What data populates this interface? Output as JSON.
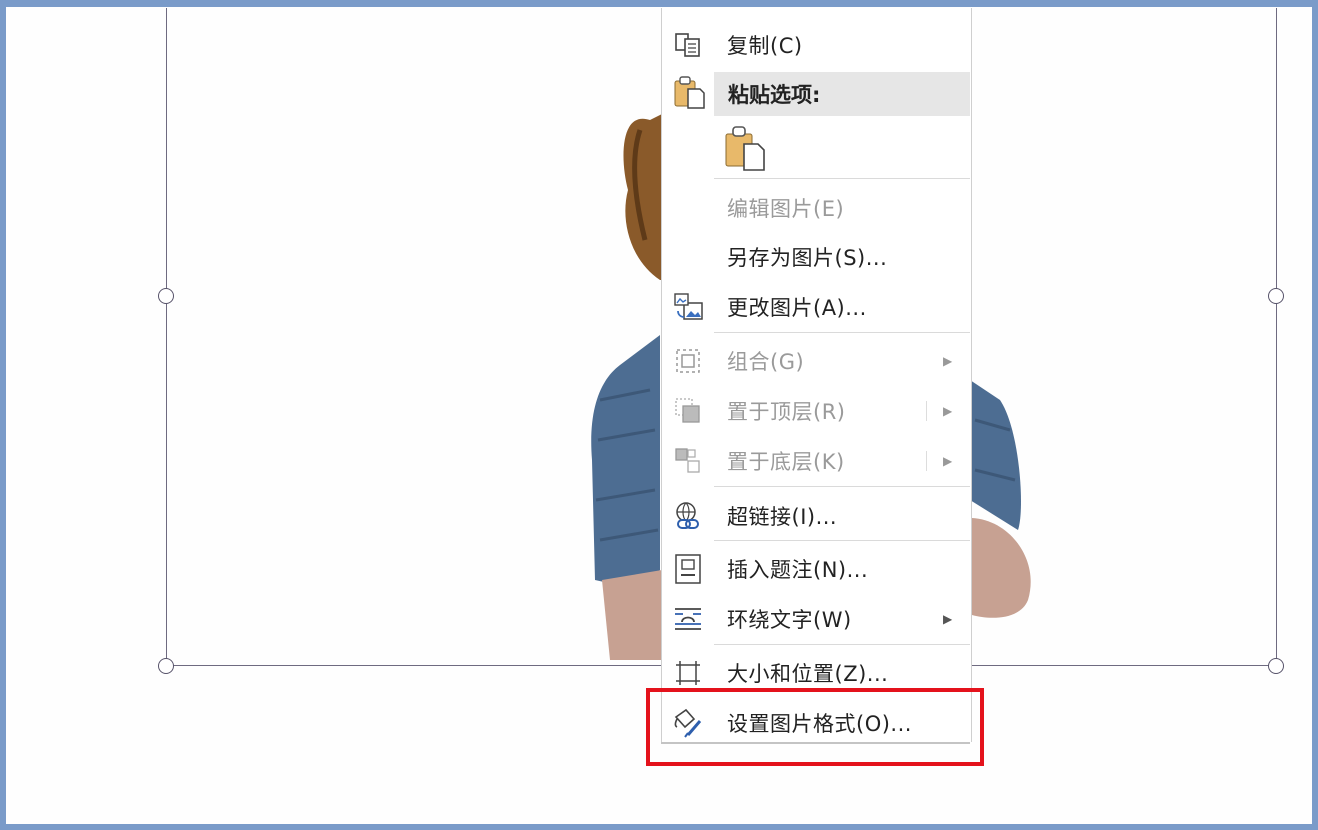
{
  "menu": {
    "copy": "复制(C)",
    "paste_options_header": "粘贴选项:",
    "edit_picture": "编辑图片(E)",
    "save_as_picture": "另存为图片(S)...",
    "change_picture": "更改图片(A)...",
    "group": "组合(G)",
    "bring_to_front": "置于顶层(R)",
    "send_to_back": "置于底层(K)",
    "hyperlink": "超链接(I)...",
    "insert_caption": "插入题注(N)...",
    "wrap_text": "环绕文字(W)",
    "size_position": "大小和位置(Z)...",
    "format_picture": "设置图片格式(O)..."
  },
  "colors": {
    "frame_border": "#7a9bc9",
    "highlight_box": "#e4121c",
    "highlighted_item_bg": "#c4c4c4"
  },
  "icons": {
    "copy": "copy-icon",
    "paste": "clipboard-icon",
    "change_picture": "change-picture-icon",
    "group": "group-icon",
    "front": "bring-front-icon",
    "back": "send-back-icon",
    "hyperlink": "hyperlink-icon",
    "caption": "caption-icon",
    "wrap": "wrap-text-icon",
    "size": "size-position-icon",
    "format": "format-picture-icon"
  }
}
